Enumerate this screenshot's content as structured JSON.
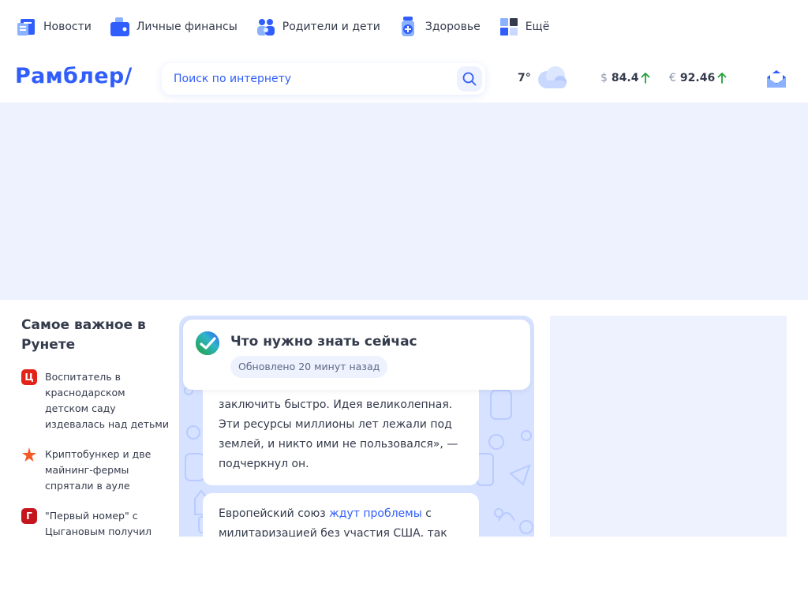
{
  "topnav": {
    "items": [
      {
        "label": "Новости",
        "icon": "newspaper-icon"
      },
      {
        "label": "Личные финансы",
        "icon": "wallet-icon"
      },
      {
        "label": "Родители и дети",
        "icon": "family-icon"
      },
      {
        "label": "Здоровье",
        "icon": "medicine-icon"
      },
      {
        "label": "Ещё",
        "icon": "grid-icon"
      }
    ]
  },
  "header": {
    "logo": "Рамблер/",
    "search_placeholder": "Поиск по интернету",
    "weather": {
      "temp": "7°",
      "icon": "cloud-icon"
    },
    "rates": [
      {
        "currency": "$",
        "value": "84.4",
        "trend": "up"
      },
      {
        "currency": "€",
        "value": "92.46",
        "trend": "up"
      }
    ],
    "mail_icon": "mail-icon"
  },
  "leftcol": {
    "title": "Самое важное в Рунете",
    "news": [
      {
        "text": "Воспитатель в краснодарском детском саду издевалась над детьми",
        "source_icon": "Ц",
        "color": "#e2231a"
      },
      {
        "text": "Криптобункер и две майнинг-фермы спрятали в ауле",
        "source_icon": "ren-tv-icon",
        "color": "#f45a26"
      },
      {
        "text": "\"Первый номер\" с Цыгановым получил",
        "source_icon": "Г",
        "color": "#c4161c"
      }
    ]
  },
  "center": {
    "title": "Что нужно знать сейчас",
    "updated": "Обновлено 20 минут назад",
    "bubble1": "заключить быстро. Идея великолепная. Эти ресурсы миллионы лет лежали под землей, и никто ими не пользовался», — подчеркнул он.",
    "bubble2_start": "Европейский союз ",
    "bubble2_link": "ждут проблемы",
    "bubble2_end": " с милитаризацией без участия США, так как"
  },
  "colors": {
    "accent": "#315efb",
    "up": "#21a038",
    "text": "#343b4c"
  }
}
